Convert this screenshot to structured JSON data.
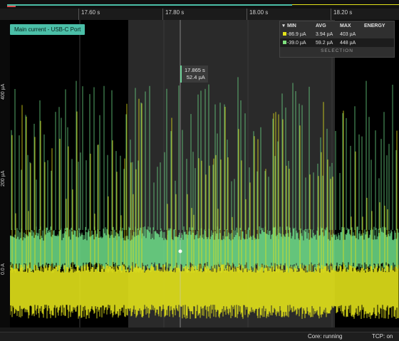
{
  "time_axis": {
    "ticks": [
      "17.60 s",
      "17.80 s",
      "18.00 s",
      "18.20 s"
    ]
  },
  "y_axis": {
    "ticks": [
      "400 µA",
      "200 µA",
      "0.0 A"
    ]
  },
  "series_tag": "Main current - USB-C Port",
  "cursor": {
    "time": "17.865 s",
    "value": "52.4 µA"
  },
  "stats": {
    "headers": [
      "MIN",
      "AVG",
      "MAX",
      "ENERGY"
    ],
    "rows": [
      {
        "min": "-86.9 µA",
        "avg": "3.94 µA",
        "max": "403 µA",
        "energy": "",
        "color": "#e2e21a"
      },
      {
        "min": "-39.0 µA",
        "avg": "59.2 µA",
        "max": "448 µA",
        "energy": "",
        "color": "#7fe07f"
      }
    ],
    "footer": "SELECTION"
  },
  "status": {
    "core": "Core: running",
    "tcp": "TCP: on"
  },
  "colors": {
    "yellow_trace": "#e2e21a",
    "green_trace": "#6fe08a",
    "teal_accent": "#4bbfa8"
  }
}
